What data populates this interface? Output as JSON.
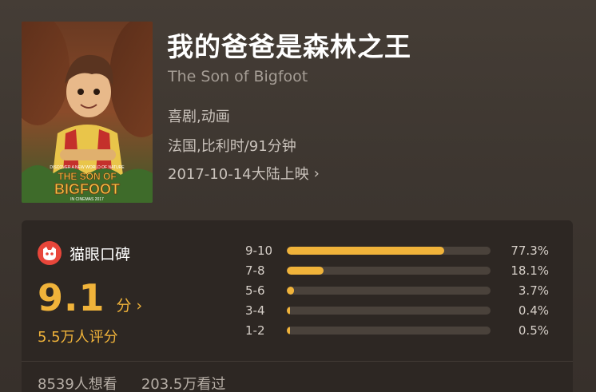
{
  "movie": {
    "title": "我的爸爸是森林之王",
    "original_title": "The Son of Bigfoot",
    "genre": "喜剧,动画",
    "country_runtime": "法国,比利时/91分钟",
    "release": "2017-10-14大陆上映",
    "release_chevron": "›",
    "poster": {
      "tagline": "DISCOVER A NEW WORLD OF NATURE",
      "title_line1": "THE SON OF",
      "title_line2": "BIGFOOT",
      "footer": "IN CINEMAS 2017"
    }
  },
  "rating": {
    "brand": "猫眼口碑",
    "score": "9.1",
    "score_unit": "分",
    "score_chevron": "›",
    "votes": "5.5万人评分",
    "distribution": [
      {
        "label": "9-10",
        "percent_text": "77.3%",
        "fraction": 0.773
      },
      {
        "label": "7-8",
        "percent_text": "18.1%",
        "fraction": 0.181
      },
      {
        "label": "5-6",
        "percent_text": "3.7%",
        "fraction": 0.037
      },
      {
        "label": "3-4",
        "percent_text": "0.4%",
        "fraction": 0.004
      },
      {
        "label": "1-2",
        "percent_text": "0.5%",
        "fraction": 0.005
      }
    ]
  },
  "stats": {
    "want_to_see": "8539人想看",
    "watched": "203.5万看过"
  },
  "colors": {
    "accent": "#f0b33a",
    "brand_red": "#e8463a",
    "background": "#3d3630"
  }
}
